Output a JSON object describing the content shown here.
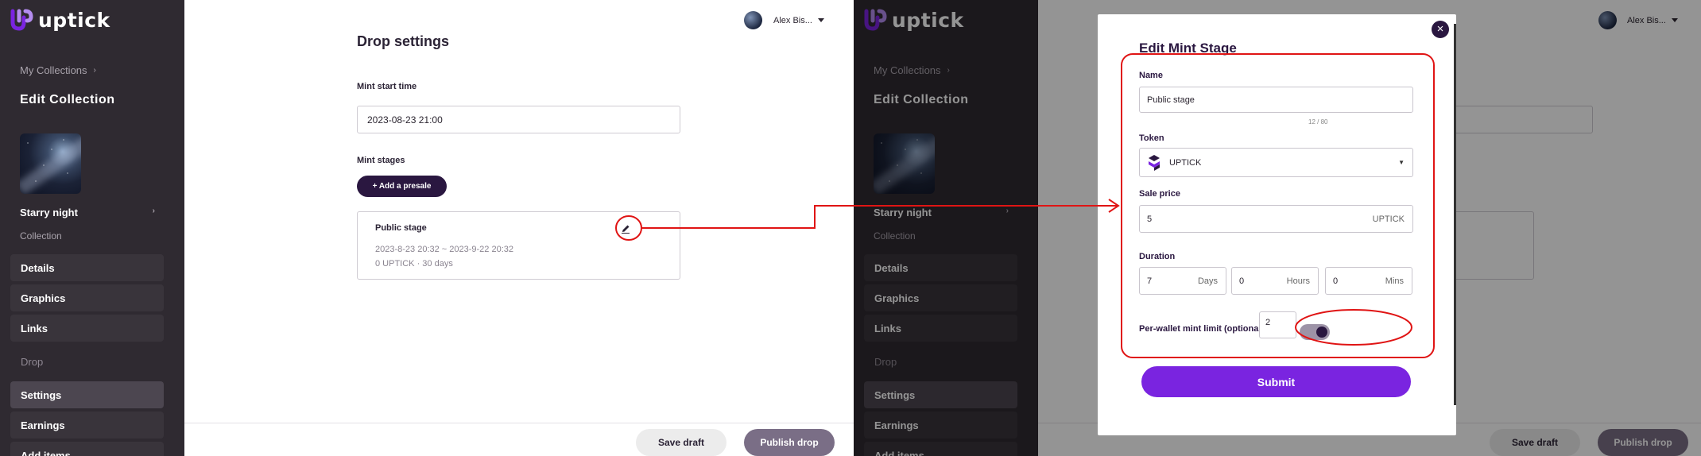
{
  "brand": {
    "name": "uptick",
    "accent": "#7a24e0",
    "dark": "#2a1740",
    "annotation_color": "#e01414"
  },
  "sidebar": {
    "breadcrumb": "My Collections",
    "title": "Edit Collection",
    "collection_name": "Starry night",
    "collection_sub": "Collection",
    "items": [
      {
        "label": "Details"
      },
      {
        "label": "Graphics"
      },
      {
        "label": "Links"
      },
      {
        "label": "Drop"
      },
      {
        "label": "Settings"
      },
      {
        "label": "Earnings"
      },
      {
        "label": "Add items"
      }
    ]
  },
  "header": {
    "user_name": "Alex Bis..."
  },
  "drop_settings": {
    "title": "Drop settings",
    "mint_start_label": "Mint start time",
    "mint_start_value": "2023-08-23 21:00",
    "mint_stages_label": "Mint stages",
    "add_presale_label": "+ Add a presale",
    "stage": {
      "name": "Public stage",
      "dates": "2023-8-23 20:32 ~ 2023-9-22 20:32",
      "meta": "0 UPTICK · 30 days"
    }
  },
  "footer": {
    "save_label": "Save draft",
    "publish_label": "Publish drop"
  },
  "modal": {
    "title": "Edit Mint Stage",
    "close_label": "×",
    "name_label": "Name",
    "name_value": "Public stage",
    "name_counter": "12 / 80",
    "token_label": "Token",
    "token_value": "UPTICK",
    "sale_price_label": "Sale price",
    "sale_price_value": "5",
    "sale_price_unit": "UPTICK",
    "duration_label": "Duration",
    "duration": [
      {
        "value": "7",
        "unit": "Days"
      },
      {
        "value": "0",
        "unit": "Hours"
      },
      {
        "value": "0",
        "unit": "Mins"
      }
    ],
    "wallet_limit_label": "Per-wallet mint limit (optional)",
    "wallet_limit_value": "2",
    "wallet_limit_enabled": true,
    "submit_label": "Submit"
  },
  "icons": [
    "uptick-logo-icon",
    "chevron-right-icon",
    "caret-down-icon",
    "pencil-icon",
    "close-icon",
    "uptick-token-icon"
  ]
}
